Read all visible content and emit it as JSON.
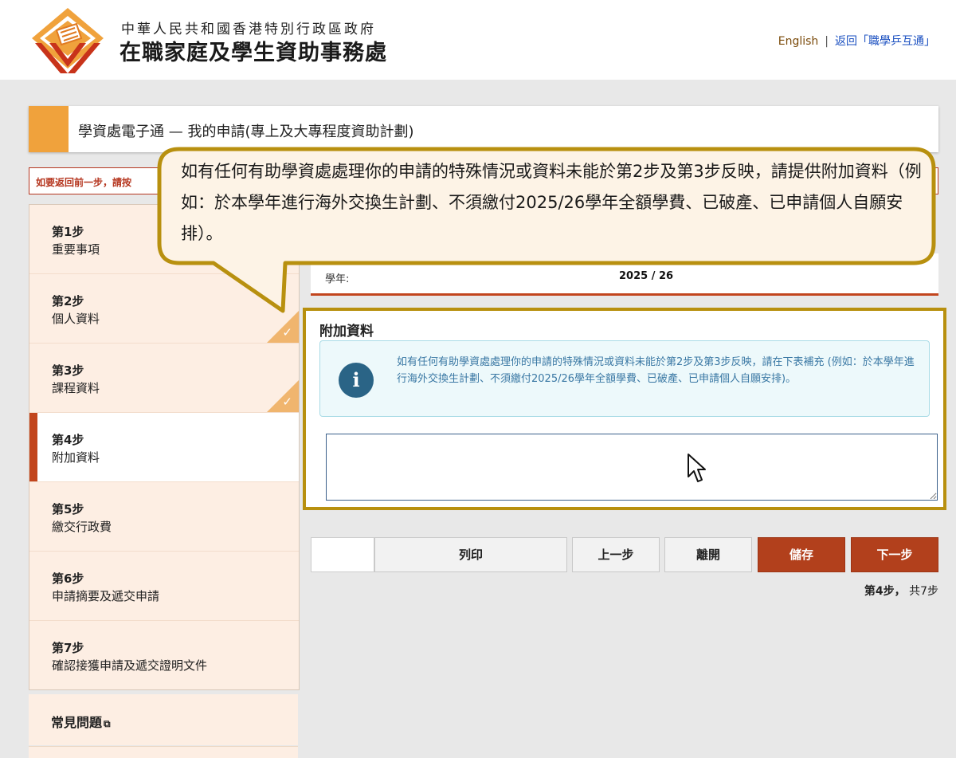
{
  "header": {
    "agency_name_line1": "中華人民共和國香港特別行政區政府",
    "agency_name_line2": "在職家庭及學生資助事務處",
    "lang_link": "English",
    "separator": "|",
    "back_link": "返回「職學乒互通」"
  },
  "page": {
    "title": "學資處電子通 — 我的申請(專上及大專程度資助計劃)",
    "notice": "如要返回前一步，請按"
  },
  "steps": [
    {
      "num": "第1步",
      "name": "重要事項",
      "completed": false,
      "active": false
    },
    {
      "num": "第2步",
      "name": "個人資料",
      "completed": true,
      "active": false
    },
    {
      "num": "第3步",
      "name": "課程資料",
      "completed": true,
      "active": false
    },
    {
      "num": "第4步",
      "name": "附加資料",
      "completed": false,
      "active": true
    },
    {
      "num": "第5步",
      "name": "繳交行政費",
      "completed": false,
      "active": false
    },
    {
      "num": "第6步",
      "name": "申請摘要及遞交申請",
      "completed": false,
      "active": false
    },
    {
      "num": "第7步",
      "name": "確認接獲申請及遞交證明文件",
      "completed": false,
      "active": false
    }
  ],
  "check_mark": "✓",
  "faq": {
    "label": "常見問題",
    "ext_icon": "⧉"
  },
  "year": {
    "label": "學年:",
    "value": "2025 / 26"
  },
  "additional_info": {
    "heading": "附加資料",
    "info_icon": "i",
    "info_text": "如有任何有助學資處處理你的申請的特殊情況或資料未能於第2步及第3步反映，請在下表補充 (例如：於本學年進行海外交換生計劃、不須繳付2025/26學年全額學費、已破產、已申請個人自願安排)。",
    "textarea_value": ""
  },
  "buttons": {
    "print": "列印",
    "prev": "上一步",
    "leave": "離開",
    "save": "儲存",
    "next": "下一步"
  },
  "step_counter": {
    "current": "第4步，",
    "total": "共7步"
  },
  "callout": {
    "text": "如有任何有助學資處處理你的申請的特殊情況或資料未能於第2步及第3步反映，請提供附加資料（例如：於本學年進行海外交換生計劃、不須繳付2025/26學年全額學費、已破產、已申請個人自願安排）。"
  },
  "colors": {
    "brand_orange": "#f0a23c",
    "brand_red": "#c2451d",
    "button_red": "#b2401c",
    "callout_border": "#b8900f",
    "callout_fill": "#fdf3e6",
    "info_blue": "#2a6486"
  }
}
